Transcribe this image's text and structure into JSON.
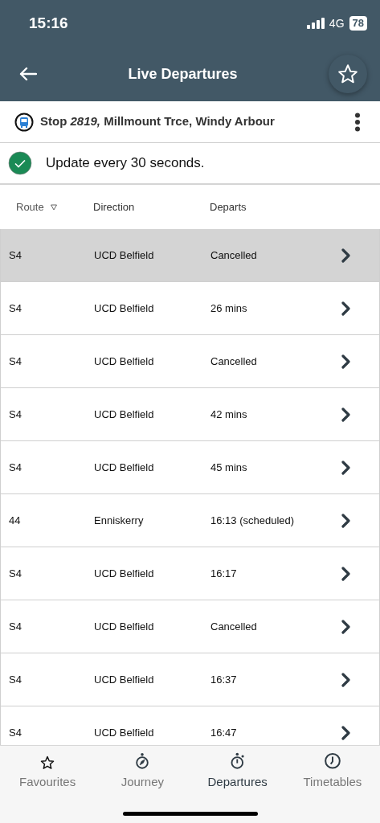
{
  "status_bar": {
    "time": "15:16",
    "network": "4G",
    "battery": "78"
  },
  "header": {
    "title": "Live Departures"
  },
  "stop": {
    "label": "Stop *2819,* Millmount Trce, Windy Arbour"
  },
  "update": {
    "text": "Update every 30 seconds.",
    "on": true
  },
  "table": {
    "columns": [
      "Route",
      "Direction",
      "Departs"
    ],
    "rows": [
      {
        "route": "S4",
        "direction": "UCD Belfield",
        "departs": "Cancelled",
        "selected": true
      },
      {
        "route": "S4",
        "direction": "UCD Belfield",
        "departs": "26 mins",
        "selected": false
      },
      {
        "route": "S4",
        "direction": "UCD Belfield",
        "departs": "Cancelled",
        "selected": false
      },
      {
        "route": "S4",
        "direction": "UCD Belfield",
        "departs": "42 mins",
        "selected": false
      },
      {
        "route": "S4",
        "direction": "UCD Belfield",
        "departs": "45 mins",
        "selected": false
      },
      {
        "route": "44",
        "direction": "Enniskerry",
        "departs": "16:13 (scheduled)",
        "selected": false
      },
      {
        "route": "S4",
        "direction": "UCD Belfield",
        "departs": "16:17",
        "selected": false
      },
      {
        "route": "S4",
        "direction": "UCD Belfield",
        "departs": "Cancelled",
        "selected": false
      },
      {
        "route": "S4",
        "direction": "UCD Belfield",
        "departs": "16:37",
        "selected": false
      },
      {
        "route": "S4",
        "direction": "UCD Belfield",
        "departs": "16:47",
        "selected": false
      }
    ]
  },
  "tabs": [
    {
      "label": "Favourites",
      "selected": false
    },
    {
      "label": "Journey",
      "selected": false
    },
    {
      "label": "Departures",
      "selected": true
    },
    {
      "label": "Timetables",
      "selected": false
    }
  ]
}
